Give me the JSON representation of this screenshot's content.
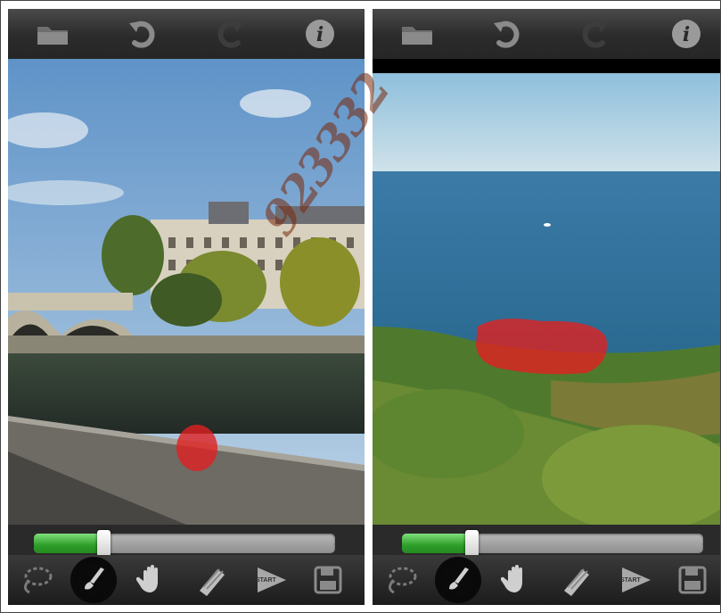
{
  "panels": [
    {
      "id": "left",
      "toolbar_top": {
        "icons": [
          "folder-icon",
          "undo-icon",
          "redo-icon",
          "info-icon"
        ]
      },
      "slider": {
        "value": 0.23
      },
      "toolbar_bottom": {
        "tools": [
          "lasso-icon",
          "brush-icon",
          "hand-icon",
          "eraser-icon",
          "start-icon",
          "save-icon"
        ],
        "active": "brush-icon",
        "start_label": "START"
      }
    },
    {
      "id": "right",
      "toolbar_top": {
        "icons": [
          "folder-icon",
          "undo-icon",
          "redo-icon",
          "info-icon"
        ]
      },
      "slider": {
        "value": 0.23
      },
      "toolbar_bottom": {
        "tools": [
          "lasso-icon",
          "brush-icon",
          "hand-icon",
          "eraser-icon",
          "start-icon",
          "save-icon"
        ],
        "active": "brush-icon",
        "start_label": "START"
      }
    }
  ],
  "watermark": {
    "text": "923332"
  },
  "colors": {
    "slider_fill": "#2e9e2a",
    "selection_mask": "#e02020",
    "sky": "#7fb0d8",
    "sea": "#2e6f9a"
  }
}
